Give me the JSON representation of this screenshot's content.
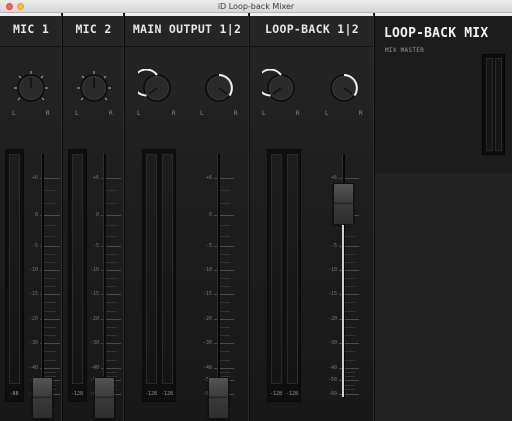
{
  "window": {
    "title": "iD Loop-back Mixer"
  },
  "strips": [
    {
      "name": "MIC 1",
      "knob_left": "L",
      "knob_right": "R",
      "meter_labels": [
        "-88"
      ],
      "fader_level_db": -60
    },
    {
      "name": "MIC 2",
      "knob_left": "L",
      "knob_right": "R",
      "meter_labels": [
        "-128"
      ],
      "fader_level_db": -60
    },
    {
      "name": "MAIN OUTPUT 1|2",
      "knob_left": [
        "L",
        "L"
      ],
      "knob_right": [
        "R",
        "R"
      ],
      "meter_labels": [
        "-128",
        "-128"
      ],
      "fader_level_db": -60
    },
    {
      "name": "LOOP-BACK 1|2",
      "knob_left": [
        "L",
        "L"
      ],
      "knob_right": [
        "R",
        "R"
      ],
      "meter_labels": [
        "-128",
        "-128"
      ],
      "fader_level_db": 0
    }
  ],
  "scale": [
    "+6",
    "0",
    "-5",
    "-10",
    "-15",
    "-20",
    "-30",
    "-40",
    "-50",
    "-60"
  ],
  "master": {
    "title": "LOOP-BACK MIX",
    "subtitle": "MIX MASTER"
  },
  "colors": {
    "accent": "#f0f0f0",
    "background": "#1b1b1b",
    "panel": "#232323"
  },
  "icons": {
    "knob": "pan-knob-icon"
  }
}
